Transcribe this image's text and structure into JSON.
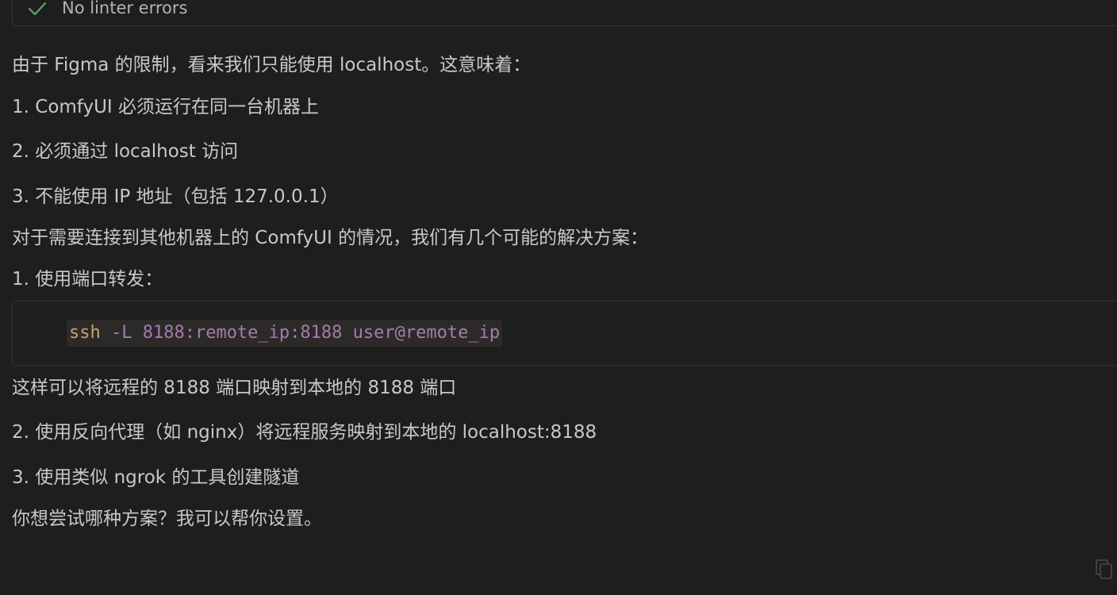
{
  "lint": {
    "icon": "check-icon",
    "text": "No linter errors"
  },
  "message": {
    "intro": "由于 Figma 的限制，看来我们只能使用 localhost。这意味着：",
    "constraints": [
      "1. ComfyUI 必须运行在同一台机器上",
      "2. 必须通过 localhost 访问",
      "3. 不能使用 IP 地址（包括 127.0.0.1）"
    ],
    "solutions_intro": "对于需要连接到其他机器上的 ComfyUI 的情况，我们有几个可能的解决方案：",
    "solution1": "1. 使用端口转发：",
    "code": {
      "cmd": "ssh",
      "args": " -L 8188:remote_ip:8188 user@remote_ip"
    },
    "code_note": "这样可以将远程的 8188 端口映射到本地的 8188 端口",
    "solution2": "2. 使用反向代理（如 nginx）将远程服务映射到本地的 localhost:8188",
    "solution3": "3. 使用类似 ngrok 的工具创建隧道",
    "question": "你想尝试哪种方案？我可以帮你设置。"
  },
  "icons": {
    "copy": "copy-icon"
  },
  "colors": {
    "background": "#1e1e1e",
    "text": "#c8c8c8",
    "check": "#5fa36b",
    "code_command": "#cba26d",
    "code_argument": "#a47bb0"
  }
}
